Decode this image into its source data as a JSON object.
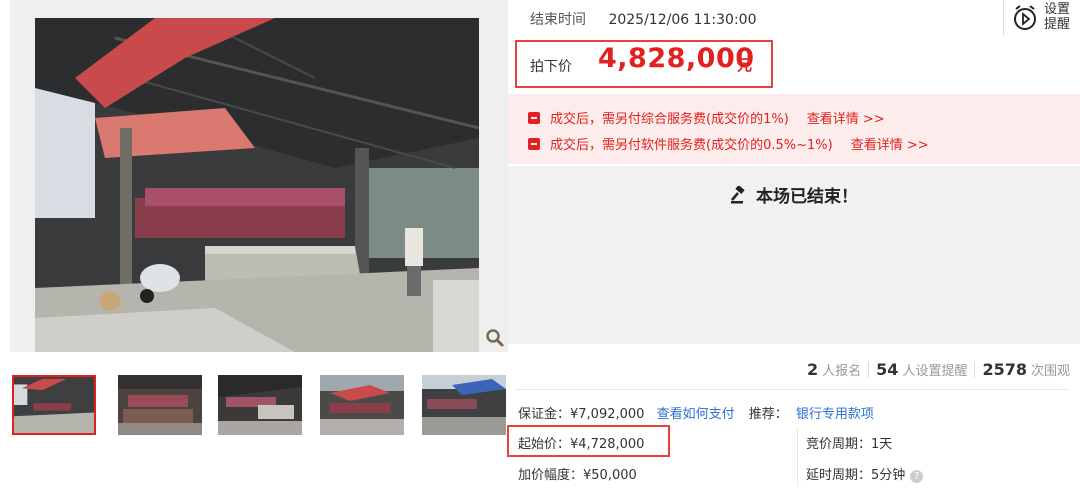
{
  "auction": {
    "end_time_label": "结束时间",
    "end_time_value": "2025/12/06 11:30:00",
    "remind_label": "设置\n提醒",
    "final_price_label": "拍下价",
    "final_price_value": "4,828,000",
    "final_price_unit": "元",
    "notices": [
      {
        "text": "成交后，需另付综合服务费(成交价的1%)",
        "link": "查看详情 >>"
      },
      {
        "text": "成交后，需另付软件服务费(成交价的0.5%~1%)",
        "link": "查看详情 >>"
      }
    ],
    "status_text": "本场已结束！"
  },
  "stats": {
    "signups_count": "2",
    "signups_label": "人报名",
    "reminders_count": "54",
    "reminders_label": "人设置提醒",
    "views_count": "2578",
    "views_label": "次围观"
  },
  "details": {
    "deposit": "保证金：¥7,092,000",
    "deposit_link": "查看如何支付",
    "recommend_label": "推荐：",
    "recommend_link": "银行专用款项",
    "start_price": "起始价：¥4,728,000",
    "increment": "加价幅度：¥50,000",
    "bid_cycle": "竞价周期：1天",
    "delay_cycle": "延时周期：5分钟"
  },
  "colors": {
    "accent": "#e1211f",
    "link": "#2a6fd6",
    "notice_bg": "#fdecec"
  },
  "icons": [
    "alarm-clock-icon",
    "zoom-icon",
    "gavel-icon",
    "fee-notice-icon",
    "help-icon"
  ]
}
